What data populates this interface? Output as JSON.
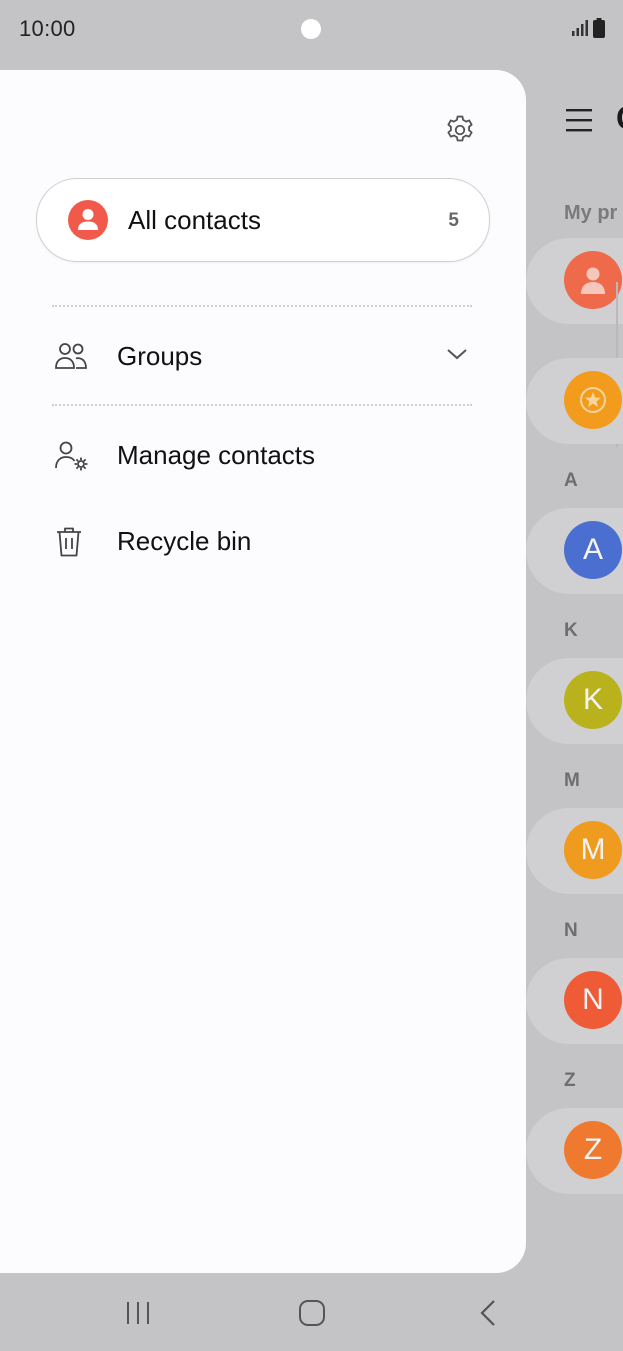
{
  "status_bar": {
    "time": "10:00",
    "icons": [
      "signal-icon",
      "battery-icon"
    ]
  },
  "drawer": {
    "settings_icon": "gear-icon",
    "all_contacts": {
      "label": "All contacts",
      "count": "5",
      "accent": "#f15a4a"
    },
    "menu": [
      {
        "label": "Groups",
        "icon": "groups-icon",
        "expandable": true
      },
      {
        "label": "Manage contacts",
        "icon": "manage-contacts-icon"
      },
      {
        "label": "Recycle bin",
        "icon": "trash-icon"
      }
    ]
  },
  "background_app": {
    "title_partial": "C",
    "my_profile_partial": "My pr",
    "sections": [
      {
        "letter": "A",
        "initial": "A",
        "color": "#4b6fd1"
      },
      {
        "letter": "K",
        "initial": "K",
        "color": "#b9b21d"
      },
      {
        "letter": "M",
        "initial": "M",
        "color": "#ef9b1f"
      },
      {
        "letter": "N",
        "initial": "N",
        "color": "#ef5a37"
      },
      {
        "letter": "Z",
        "initial": "Z",
        "color": "#ef7a2f"
      }
    ],
    "profile_avatar_color": "#ef6a4a",
    "favorites_avatar_color": "#f29b1d"
  },
  "nav_bar": {
    "buttons": [
      "recents-icon",
      "home-icon",
      "back-icon"
    ]
  }
}
